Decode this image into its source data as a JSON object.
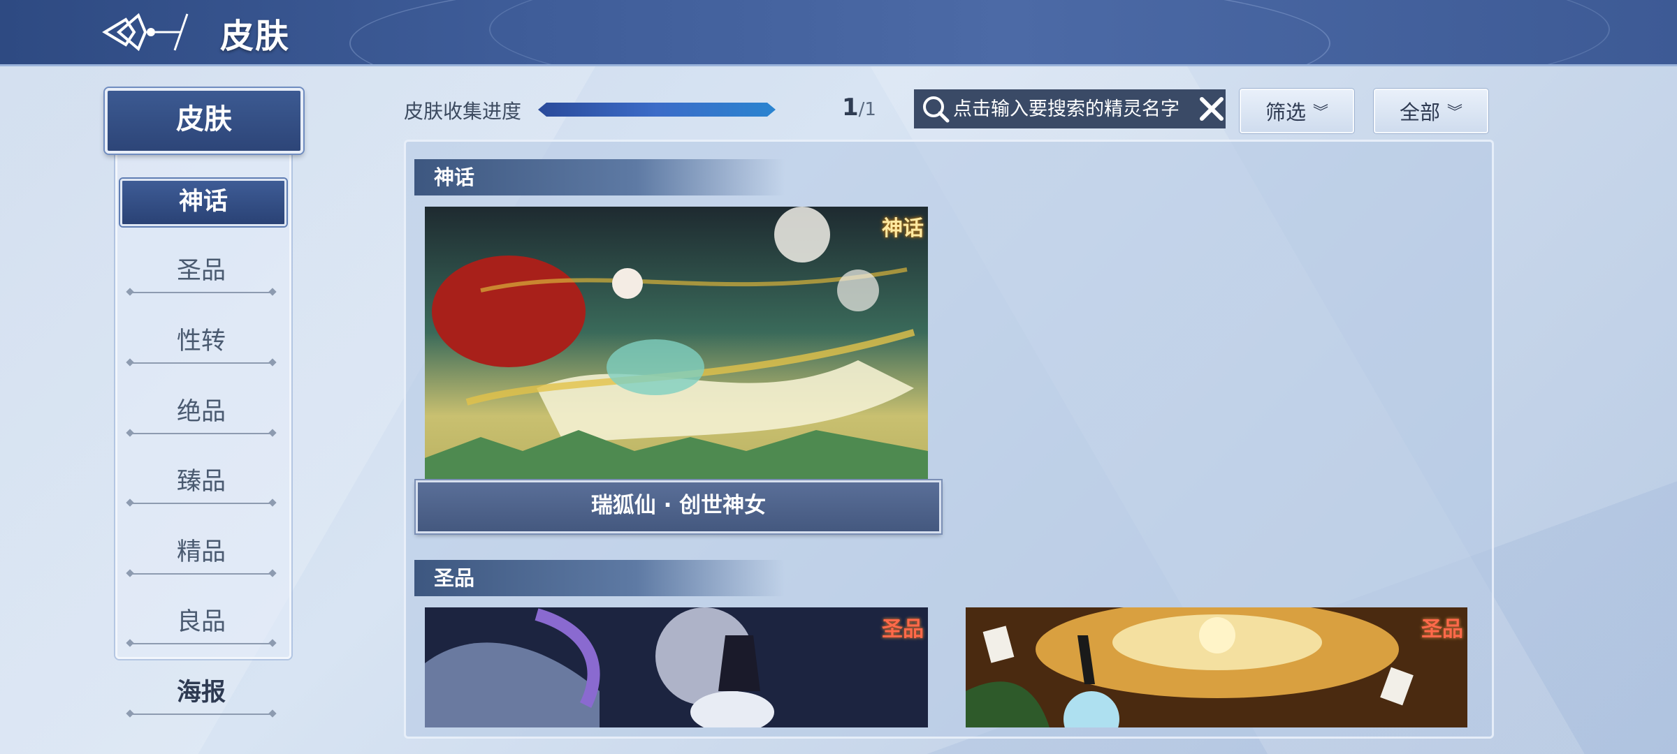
{
  "header": {
    "title": "皮肤",
    "logo_icon": "winged-emblem-icon"
  },
  "sidebar": {
    "title": "皮肤",
    "items": [
      {
        "label": "神话",
        "active": true
      },
      {
        "label": "圣品",
        "active": false
      },
      {
        "label": "性转",
        "active": false
      },
      {
        "label": "绝品",
        "active": false
      },
      {
        "label": "臻品",
        "active": false
      },
      {
        "label": "精品",
        "active": false
      },
      {
        "label": "良品",
        "active": false
      }
    ],
    "poster_label": "海报"
  },
  "progress": {
    "label": "皮肤收集进度",
    "current": "1",
    "total": "/1",
    "fraction": 1.0
  },
  "search": {
    "placeholder": "点击输入要搜索的精灵名字",
    "value": ""
  },
  "filters": {
    "filter_label": "筛选",
    "all_label": "全部"
  },
  "sections": [
    {
      "title": "神话",
      "cards": [
        {
          "name": "瑞狐仙 · 创世神女",
          "badge": "神话"
        }
      ]
    },
    {
      "title": "圣品",
      "cards": [
        {
          "name": "",
          "badge": "圣品"
        },
        {
          "name": "",
          "badge": "圣品"
        }
      ]
    }
  ],
  "colors": {
    "header": "#3e5c98",
    "accent": "#2e4a82",
    "active_tab": "#2a4275"
  }
}
